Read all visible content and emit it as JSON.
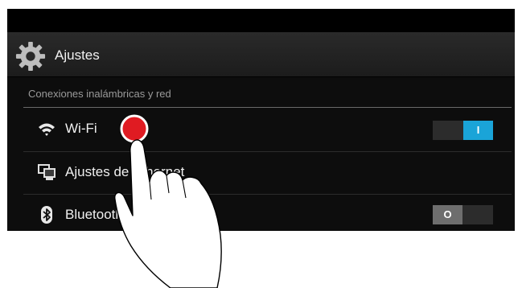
{
  "action_bar": {
    "title": "Ajustes",
    "icon": "gear-icon"
  },
  "section": {
    "header": "Conexiones inalámbricas y red"
  },
  "rows": [
    {
      "label": "Wi-Fi",
      "icon": "wifi-icon",
      "toggle": "on",
      "toggle_glyph": "I"
    },
    {
      "label": "Ajustes de Ethernet",
      "icon": "ethernet-icon"
    },
    {
      "label": "Bluetooth",
      "icon": "bluetooth-icon",
      "toggle": "off",
      "toggle_glyph": "O"
    }
  ],
  "overlay": {
    "icon": "pointing-hand-icon",
    "tap_marker_color": "#e01b22"
  },
  "colors": {
    "accent": "#1aa4d8",
    "background": "#0d0d0d",
    "tap": "#e01b22"
  }
}
